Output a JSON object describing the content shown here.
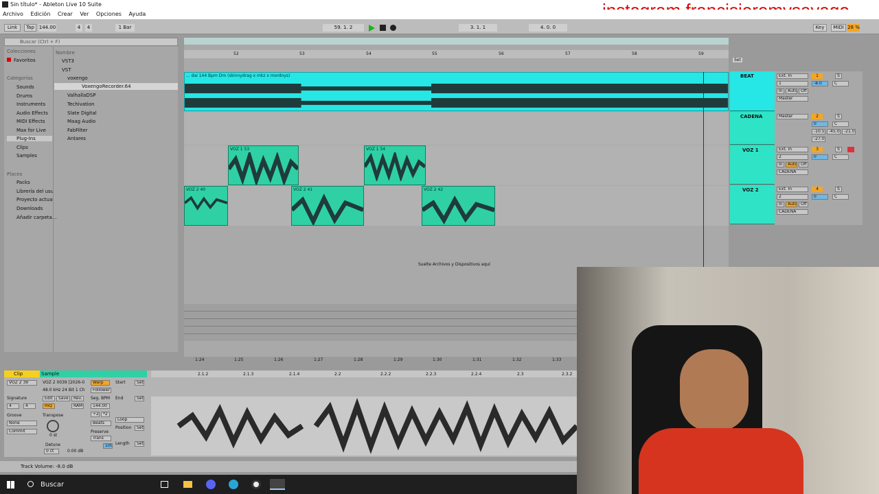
{
  "window": {
    "title": "Sin título* - Ableton Live 10 Suite"
  },
  "watermark": "instagram francisjeremysayago",
  "menu": [
    "Archivo",
    "Edición",
    "Crear",
    "Ver",
    "Opciones",
    "Ayuda"
  ],
  "control_bar": {
    "link": "Link",
    "tap": "Tap",
    "tempo": "144.00",
    "sig_num": "4",
    "sig_den": "4",
    "quant": "1 Bar",
    "position": "59.  1.  2",
    "loop_start": "3.  1.  1",
    "loop_len": "4.  0.  0",
    "key": "Key",
    "midi": "MIDI",
    "cpu": "28 %"
  },
  "browser": {
    "search_placeholder": "Buscar (Ctrl + F)",
    "colecciones": "Colecciones",
    "favoritos": "Favoritos",
    "categorias": "Categorías",
    "categories": [
      "Sounds",
      "Drums",
      "Instruments",
      "Audio Effects",
      "MIDI Effects",
      "Max for Live",
      "Plug-Ins",
      "Clips",
      "Samples"
    ],
    "places_header": "Places",
    "places": [
      "Packs",
      "Librería del usu",
      "Proyecto actual",
      "Downloads",
      "Añadir carpeta..."
    ],
    "nombre": "Nombre",
    "tree": [
      "VST3",
      "VST",
      "voxengo",
      "VoxengoRecorder.64",
      "ValhallaDSP",
      "Techivation",
      "Slate Digital",
      "Maag Audio",
      "FabFilter",
      "Antares"
    ]
  },
  "arrangement": {
    "bars": [
      "52",
      "53",
      "54",
      "55",
      "56",
      "57",
      "58",
      "59"
    ],
    "beat_clip": "... dai 144 Bpm Dm (skinnydrag x mkz x mordnys)",
    "voz1_clips": [
      "VOZ 1 53",
      "VOZ 1 54"
    ],
    "voz2_clips": [
      "VOZ 2 40",
      "VOZ 2 41",
      "VOZ 2 42"
    ],
    "drop_hint": "Suelte Archivos y Dispositivos aquí",
    "time_ruler": [
      "1:24",
      "1:25",
      "1:26",
      "1:27",
      "1:28",
      "1:29",
      "1:30",
      "1:31",
      "1:32",
      "1:33"
    ],
    "set_label": "Set"
  },
  "tracks": [
    {
      "name": "BEAT",
      "input": "Ext. In",
      "ch": "1",
      "out": "Master",
      "num": "1",
      "vol": "-8.0",
      "pan": "C"
    },
    {
      "name": "CADENA",
      "input": "Master",
      "ch": "",
      "out": "",
      "num": "2",
      "vol": "0",
      "pan": "C"
    },
    {
      "name": "VOZ 1",
      "input": "Ext. In",
      "ch": "2",
      "out": "CADENA",
      "num": "3",
      "vol": "0",
      "pan": "C"
    },
    {
      "name": "VOZ 2",
      "input": "Ext. In",
      "ch": "2",
      "out": "CADENA",
      "num": "4",
      "vol": "0",
      "pan": "C"
    }
  ],
  "track_labels": {
    "in": "In",
    "auto": "Auto",
    "off": "Off",
    "inf": "-inf",
    "s": "S",
    "cadena_vals": [
      "-10.5",
      "-45.0",
      "-21.0",
      "-27.0"
    ]
  },
  "detail": {
    "clip_tab": "Clip",
    "sample_tab": "Sample",
    "clip_name": "VOZ 2 39",
    "sample_name": "VOZ 2 0039 [2026-0",
    "sample_info": "48.0 kHz 24 Bit 1 Ch",
    "warp": "Warp",
    "follower": "Follower",
    "edit": "Edit",
    "save": "Save",
    "rev": "Rev.",
    "hiq": "HiQ",
    "ram": "RAM",
    "seg_bpm": "Seg. BPM",
    "bpm": "144.00",
    "signature": "Signature",
    "sig_a": "4",
    "sig_b": "4",
    "groove": "Groove",
    "groove_val": "None",
    "commit": "Commit",
    "transpose": "Transpose",
    "transpose_val": "0 st",
    "detune": "Detune",
    "detune_val": "0 ct",
    "gain": "0.00 dB",
    "start": "Start",
    "end": "End",
    "loop": "Loop",
    "position": "Position",
    "length": "Length",
    "beats": "Beats",
    "preserve": "Preserve",
    "trans": "Trans",
    "div2": "÷2",
    "mul2": "*2",
    "set": "Set",
    "num100": "100",
    "ruler": [
      "2.1.2",
      "2.1.3",
      "2.1.4",
      "2.2",
      "2.2.2",
      "2.2.3",
      "2.2.4",
      "2.3",
      "2.3.2"
    ]
  },
  "status": "Track Volume: -8.0 dB",
  "taskbar": {
    "search": "Buscar"
  }
}
